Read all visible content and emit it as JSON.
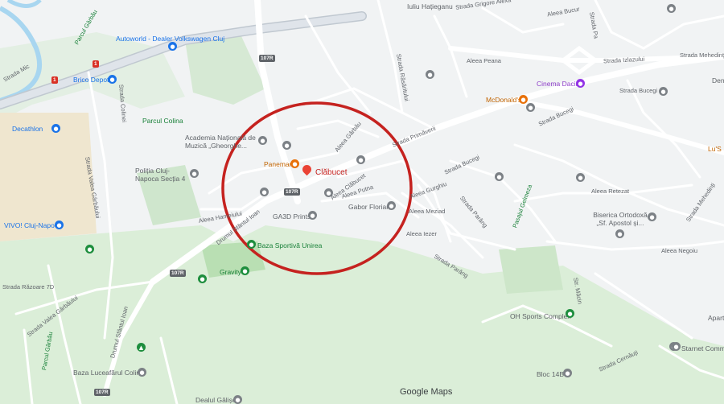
{
  "map": {
    "attribution": "Google Maps",
    "highlight_color": "#c5221f",
    "pois": {
      "autoworld": "Autoworld - Dealer Volkswagen Cluj",
      "brico": "Brico Depot",
      "decathlon": "Decathlon",
      "parcul_colina": "Parcul Colina",
      "academia": "Academia Națională de Muzică „Gheorghe...",
      "politia": "Poliția Cluj-Napoca Secția 4",
      "vivo": "VIVO! Cluj-Napoca",
      "panemar": "Panemar",
      "clabucet": "Clăbucet",
      "ga3d": "GA3D Prints",
      "gabor": "Gabor Florian",
      "baza_unirea": "Baza Sportivă Unirea",
      "gravity": "Gravity",
      "cinema": "Cinema Dacia",
      "mcdonalds": "McDonald's",
      "biserica": "Biserica Ortodoxă „Sf. Apostol și...",
      "oh_sports": "OH Sports Complex",
      "starnet": "Starnet Commu",
      "bloc": "Bloc 14B",
      "baza_luceafarul": "Baza Luceafărul Colina",
      "dealul": "Dealul Gâlișer",
      "lus": "Lu'S",
      "den": "Den",
      "apart": "Apart",
      "iuliu": "Iuliu Hațieganu"
    },
    "streets": {
      "grigore": "Strada Grigore Alexa",
      "aleea_bucur": "Aleea Bucur",
      "aleea_pesna": "Aleea Peana",
      "strada_izlazului": "Strada Izlazului",
      "strada_mehedinti_top": "Strada Mehedinți",
      "strada_bucegi_right": "Strada Bucegi",
      "strada_bucegi_mid": "Strada Bucegi",
      "strada_bucegi_low": "Strada Bucegi",
      "strada_primaverii": "Strada Primăverii",
      "strada_rasaritului": "Strada Răsăritului",
      "aleea_garbau": "Aleea Gârbău",
      "aleea_clabucet": "Aleea Clăbucet",
      "aleea_putna": "Aleea Putna",
      "aleea_gurghiu": "Aleea Gurghiu",
      "aleea_meziad": "Aleea Meziad",
      "aleea_iezer": "Aleea Iezer",
      "strada_parang_a": "Strada Parâng",
      "strada_parang_b": "Strada Parâng",
      "pasajul_gelmeza": "Pasajul Gelmeza",
      "aleea_retezat": "Aleea Retezat",
      "strada_mehedinti_r": "Strada Mehedinți",
      "aleea_negoiu": "Aleea Negoiu",
      "drumul_fs_ioan": "Drumul Sfântul Ioan",
      "drumul_fs_ioan_2": "Drumul Sfântul Ioan",
      "strada_valea_garbaului": "Strada Valea Gârbăului",
      "strada_valea_garbaului_2": "Strada Valea Gârbăului",
      "strada_razoare": "Strada Răzoare 7D",
      "strada_colinei": "Strada Colinei",
      "aleea_hamelor": "Aleea Hameiului",
      "parcul_garbau": "Parcul Gârbău",
      "parcul_garbau_2": "Parcul Gârbău",
      "strada_martin": "Str. Măcin",
      "strada_cernauti": "Strada Cernăuți",
      "strada_mic": "Strada Mic",
      "strada_pa": "Strada Pa"
    },
    "shields": {
      "r1": "1",
      "r2": "1",
      "r3": "107R",
      "r4": "107R",
      "r5": "107R",
      "r6": "107R"
    }
  }
}
